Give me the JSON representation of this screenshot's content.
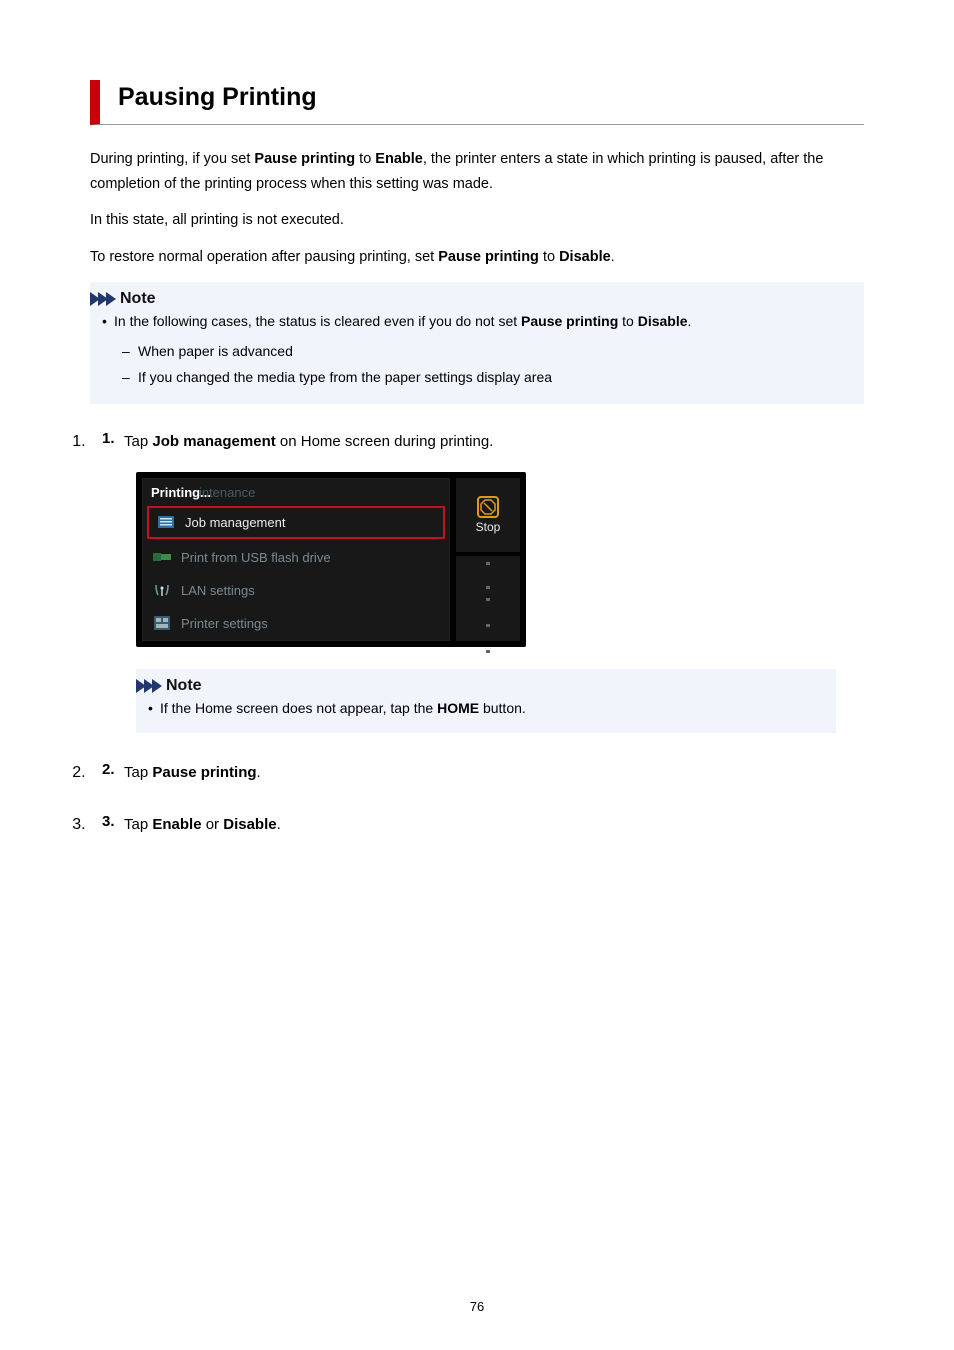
{
  "title": "Pausing Printing",
  "para1": {
    "pre": "During printing, if you set ",
    "b1": "Pause printing",
    "mid1": " to ",
    "b2": "Enable",
    "post": ", the printer enters a state in which printing is paused, after the completion of the printing process when this setting was made."
  },
  "para2": "In this state, all printing is not executed.",
  "para3": {
    "pre": "To restore normal operation after pausing printing, set ",
    "b1": "Pause printing",
    "mid1": " to ",
    "b2": "Disable",
    "post": "."
  },
  "note1": {
    "header": "Note",
    "bullet_pre": "In the following cases, the status is cleared even if you do not set ",
    "bullet_b1": "Pause printing",
    "bullet_mid": " to ",
    "bullet_b2": "Disable",
    "bullet_post": ".",
    "sub1": "When paper is advanced",
    "sub2": "If you changed the media type from the paper settings display area"
  },
  "steps": {
    "s1": {
      "num": "1.",
      "pre": "Tap ",
      "b1": "Job management",
      "post": " on Home screen during printing."
    },
    "s2": {
      "num": "2.",
      "pre": "Tap ",
      "b1": "Pause printing",
      "post": "."
    },
    "s3": {
      "num": "3.",
      "pre": "Tap ",
      "b1": "Enable",
      "mid": " or ",
      "b2": "Disable",
      "post": "."
    }
  },
  "screen": {
    "header_text": "Printing...",
    "header_ghost": "intenance",
    "items": {
      "job_mgmt": "Job management",
      "usb": "Print from USB flash drive",
      "lan": "LAN settings",
      "printer": "Printer settings"
    },
    "stop_label": "Stop"
  },
  "note2": {
    "header": "Note",
    "bullet_pre": "If the Home screen does not appear, tap the ",
    "bullet_b1": "HOME",
    "bullet_post": " button."
  },
  "page_number": "76"
}
